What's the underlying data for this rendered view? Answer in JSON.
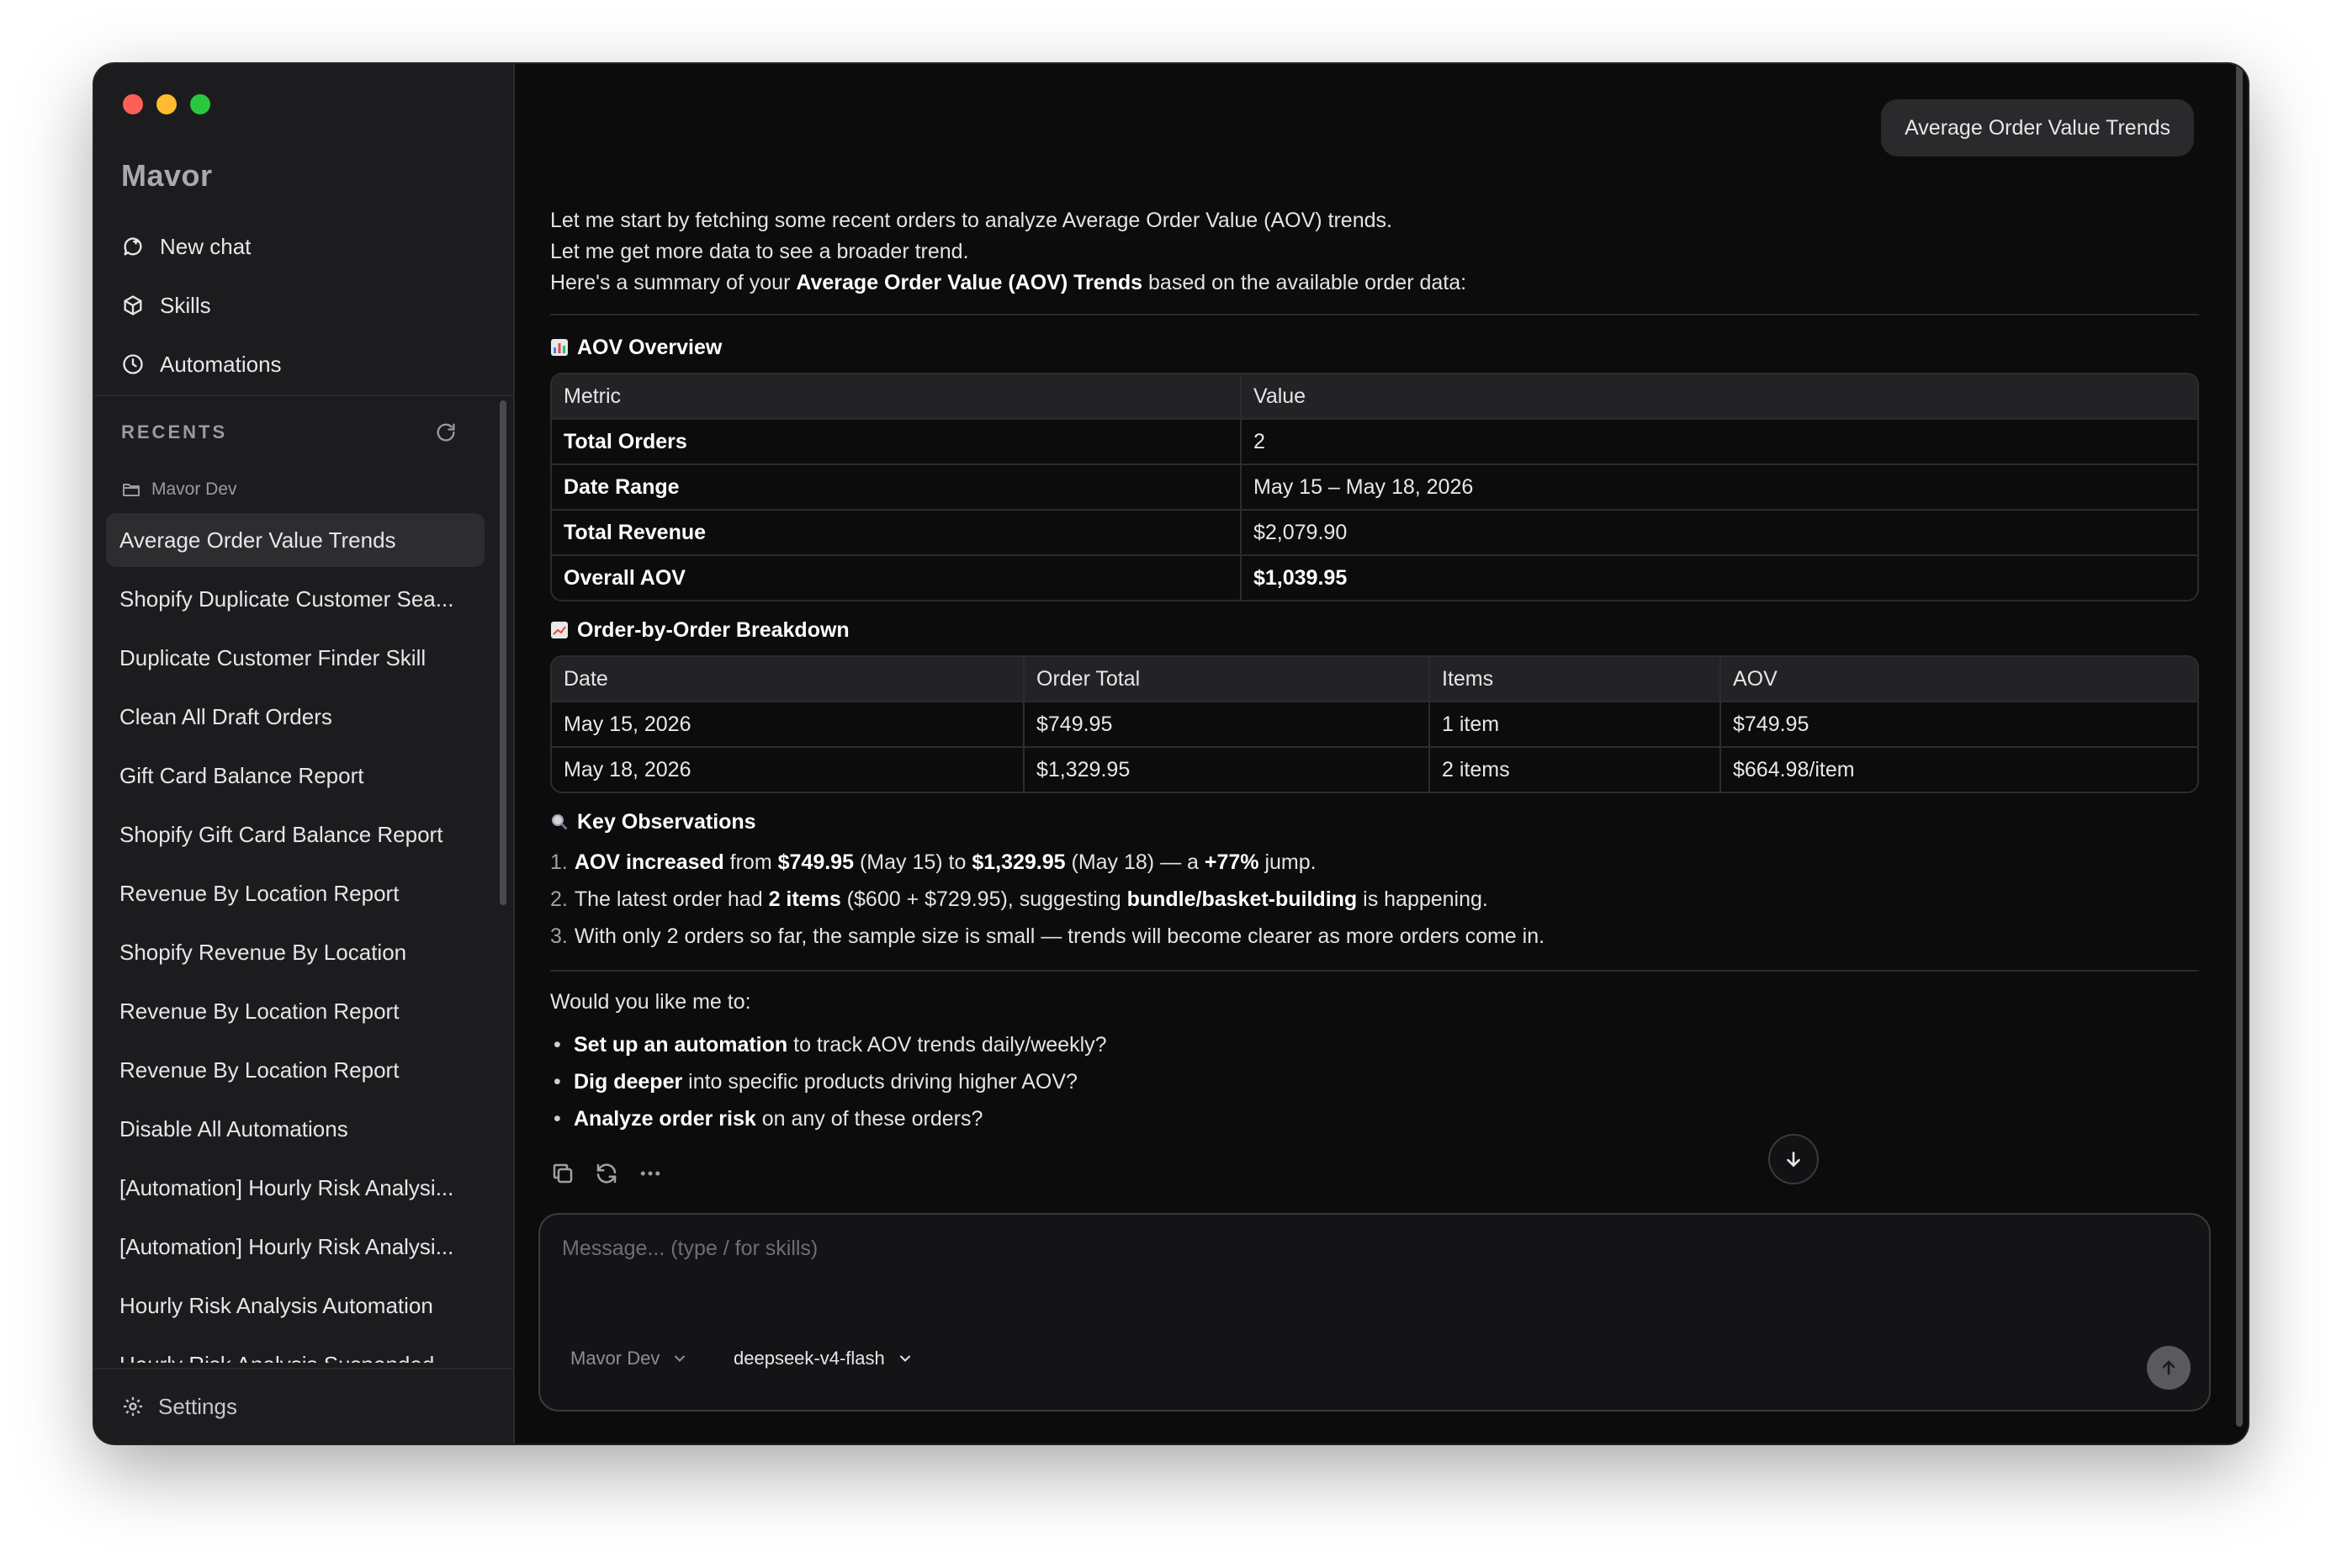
{
  "app": {
    "name": "Mavor",
    "conversation_title": "Average Order Value Trends"
  },
  "sidebar": {
    "nav": [
      {
        "label": "New chat",
        "icon": "new-chat-icon"
      },
      {
        "label": "Skills",
        "icon": "skills-icon"
      },
      {
        "label": "Automations",
        "icon": "clock-icon"
      }
    ],
    "recents_label": "RECENTS",
    "folder": "Mavor Dev",
    "recents": [
      "Average Order Value Trends",
      "Shopify Duplicate Customer Sea...",
      "Duplicate Customer Finder Skill",
      "Clean All Draft Orders",
      "Gift Card Balance Report",
      "Shopify Gift Card Balance Report",
      "Revenue By Location Report",
      "Shopify Revenue By Location",
      "Revenue By Location Report",
      "Revenue By Location Report",
      "Disable All Automations",
      "[Automation] Hourly Risk Analysi...",
      "[Automation] Hourly Risk Analysi...",
      "Hourly Risk Analysis Automation",
      "Hourly Risk Analysis Suspended"
    ],
    "settings_label": "Settings"
  },
  "message": {
    "intro_1": "Let me start by fetching some recent orders to analyze Average Order Value (AOV) trends.",
    "intro_2": "Let me get more data to see a broader trend.",
    "intro_3_pre": "Here's a summary of your ",
    "intro_3_bold": "Average Order Value (AOV) Trends",
    "intro_3_post": " based on the available order data:",
    "overview_title": "AOV Overview",
    "overview_headers": [
      "Metric",
      "Value"
    ],
    "overview_rows": [
      [
        "Total Orders",
        "2"
      ],
      [
        "Date Range",
        "May 15 – May 18, 2026"
      ],
      [
        "Total Revenue",
        "$2,079.90"
      ],
      [
        "Overall AOV",
        "$1,039.95"
      ]
    ],
    "breakdown_title": "Order-by-Order Breakdown",
    "breakdown_headers": [
      "Date",
      "Order Total",
      "Items",
      "AOV"
    ],
    "breakdown_rows": [
      [
        "May 15, 2026",
        "$749.95",
        "1 item",
        "$749.95"
      ],
      [
        "May 18, 2026",
        "$1,329.95",
        "2 items",
        "$664.98/item"
      ]
    ],
    "observations_title": "Key Observations",
    "obs": {
      "n1": "1.",
      "o1_b1": "AOV increased",
      "o1_t1": " from ",
      "o1_b2": "$749.95",
      "o1_t2": " (May 15) to ",
      "o1_b3": "$1,329.95",
      "o1_t3": " (May 18) — a ",
      "o1_b4": "+77%",
      "o1_t4": " jump.",
      "n2": "2.",
      "o2_t1": "The latest order had ",
      "o2_b1": "2 items",
      "o2_t2": " ($600 + $729.95), suggesting ",
      "o2_b2": "bundle/basket-building",
      "o2_t3": " is happening.",
      "n3": "3.",
      "o3_t1": "With only 2 orders so far, the sample size is small — trends will become clearer as more orders come in."
    },
    "followup": "Would you like me to:",
    "bullets": {
      "b1_bold": "Set up an automation",
      "b1_text": " to track AOV trends daily/weekly?",
      "b2_bold": "Dig deeper",
      "b2_text": " into specific products driving higher AOV?",
      "b3_bold": "Analyze order risk",
      "b3_text": " on any of these orders?"
    }
  },
  "composer": {
    "placeholder": "Message... (type / for skills)",
    "project": "Mavor Dev",
    "model": "deepseek-v4-flash"
  }
}
